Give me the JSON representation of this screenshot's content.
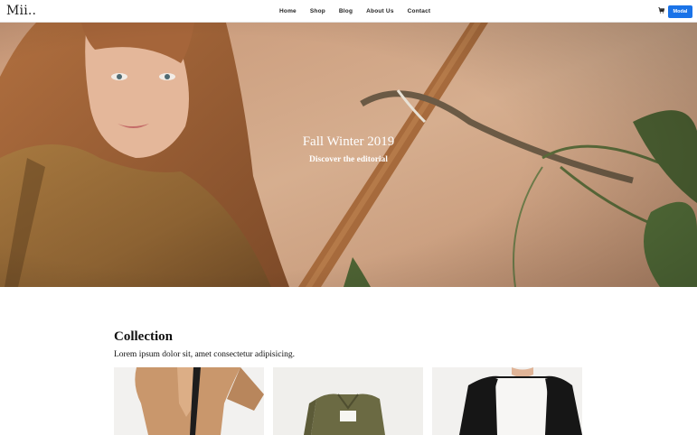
{
  "header": {
    "logo": "Mii..",
    "nav": [
      "Home",
      "Shop",
      "Blog",
      "About Us",
      "Contact"
    ],
    "cart_icon": "cart-icon",
    "modal_button": "Modal",
    "accent_color": "#1a73e8"
  },
  "hero": {
    "title": "Fall Winter 2019",
    "subtitle": "Discover the editorial"
  },
  "collection": {
    "title": "Collection",
    "description": "Lorem ipsum dolor sit, amet consectetur adipisicing."
  }
}
